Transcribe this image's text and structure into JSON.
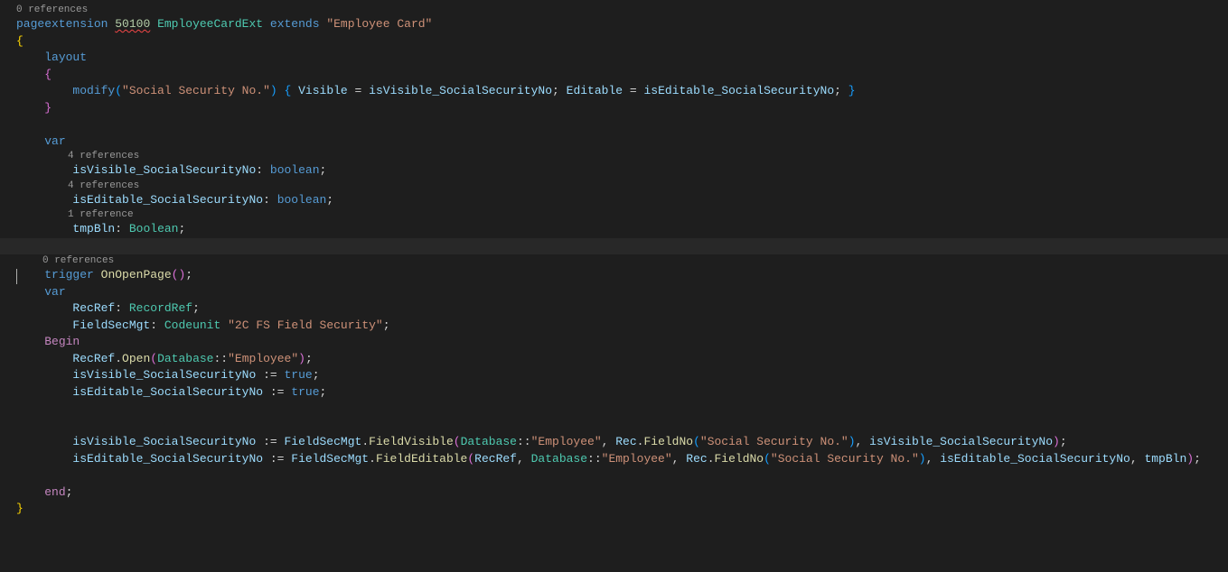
{
  "codelens": {
    "zero": "0 references",
    "four": "4 references",
    "one": "1 reference"
  },
  "tokens": {
    "pageextension": "pageextension",
    "id": "50100",
    "objName": "EmployeeCardExt",
    "extends": "extends",
    "target": "\"Employee Card\"",
    "layout": "layout",
    "modify": "modify",
    "modifyTarget": "\"Social Security No.\"",
    "visible": "Visible",
    "editable": "Editable",
    "isVis": "isVisible_SocialSecurityNo",
    "isEdit": "isEditable_SocialSecurityNo",
    "var": "var",
    "boolean": "boolean",
    "Boolean": "Boolean",
    "tmpBln": "tmpBln",
    "trigger": "trigger",
    "onopen": "OnOpenPage",
    "recref": "RecRef",
    "recordref": "RecordRef",
    "fieldsecmgt": "FieldSecMgt",
    "codeunit": "Codeunit",
    "cuName": "\"2C FS Field Security\"",
    "begin": "Begin",
    "open": "Open",
    "database": "Database",
    "employee": "\"Employee\"",
    "true": "true",
    "fieldvisible": "FieldVisible",
    "fieldeditable": "FieldEditable",
    "rec": "Rec",
    "fieldno": "FieldNo",
    "end": "end"
  }
}
